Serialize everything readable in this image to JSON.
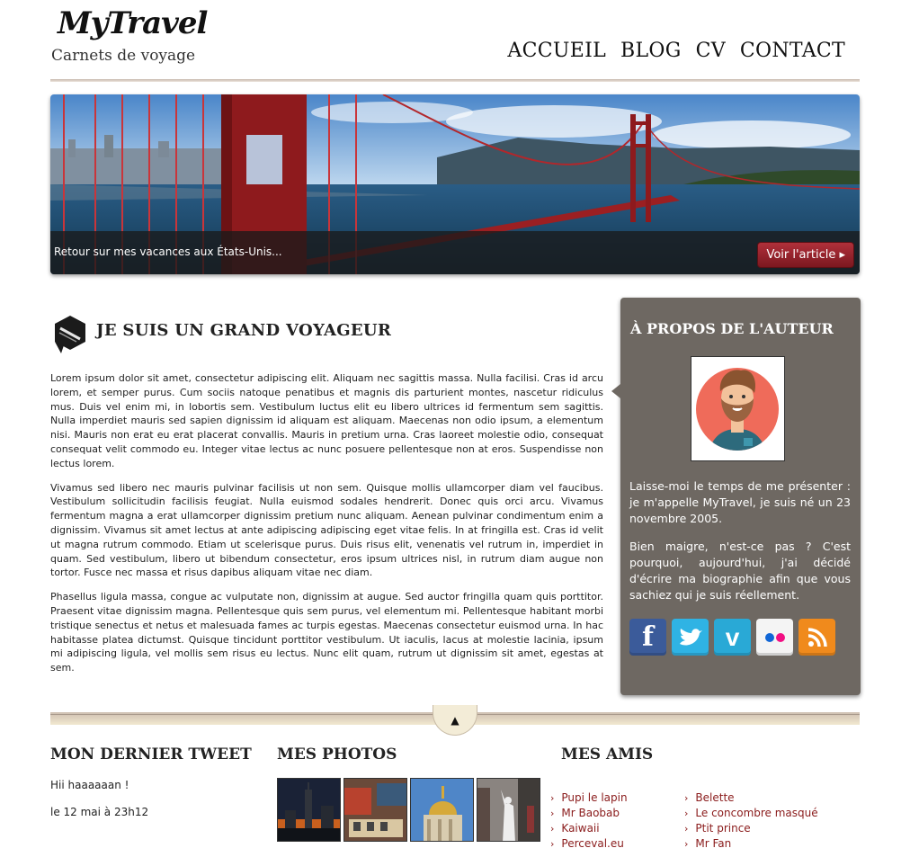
{
  "header": {
    "logo": "MyTravel",
    "tagline": "Carnets de voyage",
    "nav": [
      "ACCUEIL",
      "BLOG",
      "CV",
      "CONTACT"
    ]
  },
  "banner": {
    "caption": "Retour sur mes vacances aux États-Unis...",
    "button_label": "Voir l'article",
    "button_icon": "caret-right-icon"
  },
  "article": {
    "icon": "pencil-badge-icon",
    "title": "JE SUIS UN GRAND VOYAGEUR",
    "paragraphs": [
      "Lorem ipsum dolor sit amet, consectetur adipiscing elit. Aliquam nec sagittis massa. Nulla facilisi. Cras id arcu lorem, et semper purus. Cum sociis natoque penatibus et magnis dis parturient montes, nascetur ridiculus mus. Duis vel enim mi, in lobortis sem. Vestibulum luctus elit eu libero ultrices id fermentum sem sagittis. Nulla imperdiet mauris sed sapien dignissim id aliquam est aliquam. Maecenas non odio ipsum, a elementum nisi. Mauris non erat eu erat placerat convallis. Mauris in pretium urna. Cras laoreet molestie odio, consequat consequat velit commodo eu. Integer vitae lectus ac nunc posuere pellentesque non at eros. Suspendisse non lectus lorem.",
      "Vivamus sed libero nec mauris pulvinar facilisis ut non sem. Quisque mollis ullamcorper diam vel faucibus. Vestibulum sollicitudin facilisis feugiat. Nulla euismod sodales hendrerit. Donec quis orci arcu. Vivamus fermentum magna a erat ullamcorper dignissim pretium nunc aliquam. Aenean pulvinar condimentum enim a dignissim. Vivamus sit amet lectus at ante adipiscing adipiscing eget vitae felis. In at fringilla est. Cras id velit ut magna rutrum commodo. Etiam ut scelerisque purus. Duis risus elit, venenatis vel rutrum in, imperdiet in quam. Sed vestibulum, libero ut bibendum consectetur, eros ipsum ultrices nisl, in rutrum diam augue non tortor. Fusce nec massa et risus dapibus aliquam vitae nec diam.",
      "Phasellus ligula massa, congue ac vulputate non, dignissim at augue. Sed auctor fringilla quam quis porttitor. Praesent vitae dignissim magna. Pellentesque quis sem purus, vel elementum mi. Pellentesque habitant morbi tristique senectus et netus et malesuada fames ac turpis egestas. Maecenas consectetur euismod urna. In hac habitasse platea dictumst. Quisque tincidunt porttitor vestibulum. Ut iaculis, lacus at molestie lacinia, ipsum mi adipiscing ligula, vel mollis sem risus eu lectus. Nunc elit quam, rutrum ut dignissim sit amet, egestas at sem."
    ]
  },
  "sidebar": {
    "title": "À PROPOS DE L'AUTEUR",
    "paragraphs": [
      "Laisse-moi le temps de me présenter : je m'appelle MyTravel, je suis né un 23 novembre 2005.",
      "Bien maigre, n'est-ce pas ? C'est pourquoi, aujourd'hui, j'ai décidé d'écrire ma biographie afin que vous sachiez qui je suis réellement."
    ],
    "socials": [
      {
        "name": "facebook-icon",
        "glyph": "f",
        "color": "#3b5b9a"
      },
      {
        "name": "twitter-icon",
        "glyph": "t",
        "color": "#2fb3e4"
      },
      {
        "name": "vimeo-icon",
        "glyph": "v",
        "color": "#29a9d6"
      },
      {
        "name": "flickr-icon",
        "glyph": "••",
        "color": "#f4f4f4"
      },
      {
        "name": "rss-icon",
        "glyph": "◜",
        "color": "#f08a1c"
      }
    ]
  },
  "footer": {
    "up_icon": "arrow-up-icon",
    "tweet": {
      "title": "MON DERNIER TWEET",
      "text": "Hii haaaaaan !",
      "date": "le 12 mai à 23h12"
    },
    "photos": {
      "title": "MES PHOTOS",
      "items": [
        "city-skyline-night",
        "street-scene",
        "golden-dome",
        "statue-of-liberty"
      ]
    },
    "friends": {
      "title": "MES AMIS",
      "col1": [
        "Pupi le lapin",
        "Mr Baobab",
        "Kaiwaii",
        "Perceval.eu"
      ],
      "col2": [
        "Belette",
        "Le concombre masqué",
        "Ptit prince",
        "Mr Fan"
      ]
    }
  }
}
